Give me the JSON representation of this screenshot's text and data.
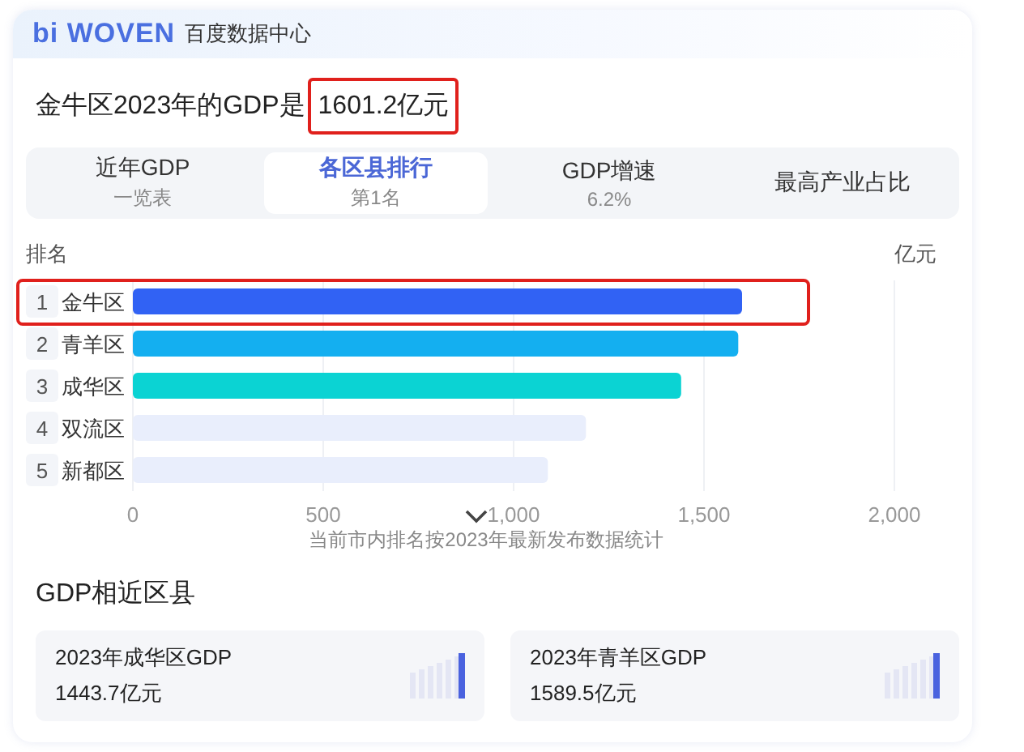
{
  "brand": {
    "logo": "bi WOVEN",
    "name": "百度数据中心"
  },
  "headline": {
    "text": "金牛区2023年的GDP是",
    "value": "1601.2亿元",
    "highlighted": true
  },
  "tabs": [
    {
      "label": "近年GDP",
      "sub": "一览表",
      "selected": false
    },
    {
      "label": "各区县排行",
      "sub": "第1名",
      "selected": true
    },
    {
      "label": "GDP增速",
      "sub": "6.2%",
      "selected": false
    },
    {
      "label": "最高产业占比",
      "selected": false
    }
  ],
  "ranking": {
    "rows": [
      {
        "rank": "1",
        "highlighted": true,
        "color": "#3162f4"
      },
      {
        "rank": "2",
        "highlighted": false,
        "color": "#14aff0"
      },
      {
        "rank": "3",
        "highlighted": false,
        "color": "#0bd3d3"
      },
      {
        "rank": "4",
        "highlighted": false,
        "color": "#e9eefc"
      },
      {
        "rank": "5",
        "highlighted": false,
        "color": "#e9eefc"
      }
    ],
    "chart_data": {
      "type": "bar",
      "orientation": "horizontal",
      "ylabel": "排名",
      "xlabel": "亿元",
      "categories": [
        "金牛区",
        "青羊区",
        "成华区",
        "双流区",
        "新都区"
      ],
      "values": [
        1600,
        1590,
        1440,
        1190,
        1090
      ],
      "grid": true,
      "xlim": [
        0,
        2000
      ],
      "xticks": [
        0,
        500,
        {
          "value": 1000,
          "label": "1,000"
        },
        {
          "value": 1500,
          "label": "1,500"
        },
        {
          "value": 2000,
          "label": "2,000"
        }
      ]
    },
    "note": "当前市内排名按2023年最新发布数据统计"
  },
  "similar": {
    "title": "GDP相近区县",
    "cards": [
      {
        "label": "2023年成华区GDP",
        "value": "1443.7亿元"
      },
      {
        "label": "2023年青羊区GDP",
        "value": "1589.5亿元"
      }
    ]
  }
}
